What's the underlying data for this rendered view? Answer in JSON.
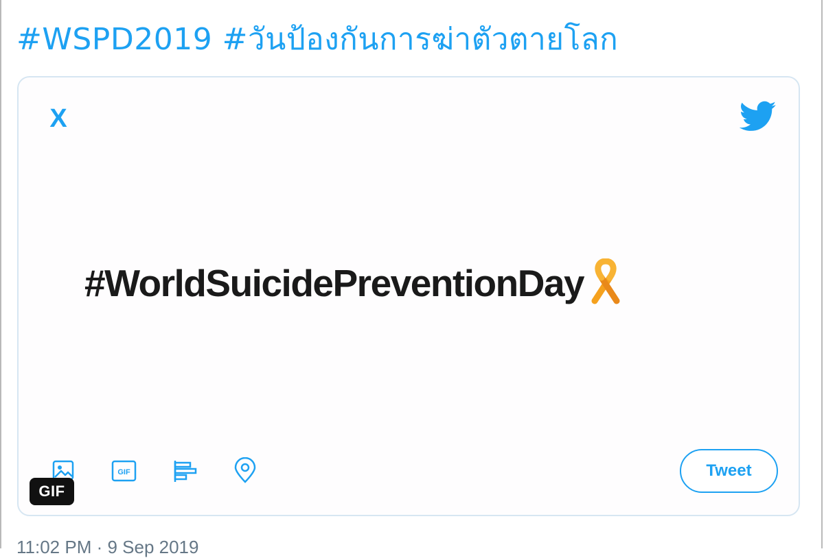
{
  "tweet": {
    "text": "#WSPD2019 #วันป้องกันการฆ่าตัวตายโลก",
    "timestamp": "11:02 PM · 9 Sep 2019",
    "link_color": "#1da1f2"
  },
  "media": {
    "close_label": "X",
    "hashtag": "#WorldSuicidePreventionDay",
    "icons": [
      "close-icon",
      "twitter-bird-icon",
      "awareness-ribbon-icon",
      "image-icon",
      "gif-icon",
      "poll-icon",
      "location-pin-icon"
    ],
    "ribbon_color": "#f5a11e",
    "gif_icon_label": "GIF",
    "tweet_button_label": "Tweet",
    "badge_label": "GIF"
  }
}
